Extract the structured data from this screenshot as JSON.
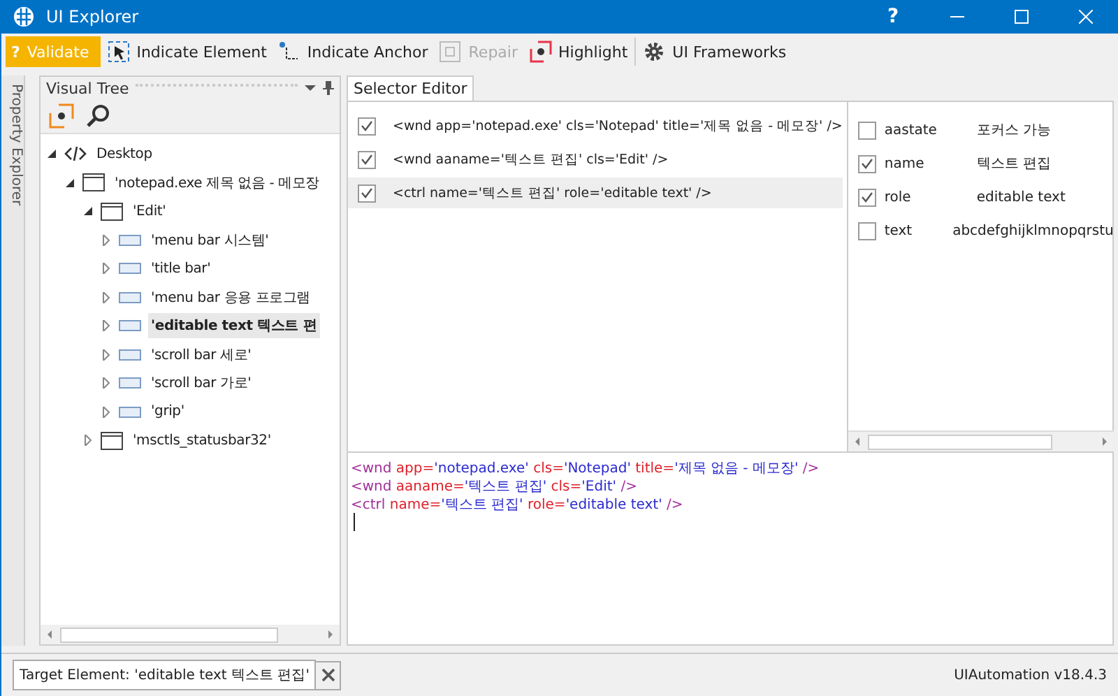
{
  "window": {
    "title": "UI Explorer",
    "help": "?"
  },
  "toolbar": [
    {
      "label": "Validate",
      "glyph": "?",
      "kind": "primary",
      "disabled": false
    },
    {
      "label": "Indicate Element",
      "kind": "element",
      "disabled": false
    },
    {
      "label": "Indicate Anchor",
      "kind": "anchor",
      "disabled": false
    },
    {
      "label": "Repair",
      "kind": "repair",
      "disabled": true
    },
    {
      "label": "Highlight",
      "kind": "highlight",
      "disabled": false
    },
    {
      "label": "UI Frameworks",
      "kind": "gear",
      "disabled": false
    }
  ],
  "side_tab": {
    "label": "Property Explorer"
  },
  "visual_tree": {
    "title": "Visual Tree",
    "items": [
      {
        "label": "Desktop",
        "kind": "desktop",
        "expanded": true,
        "selected": false,
        "children": [
          {
            "label": "'notepad.exe  제목 없음 - 메모장",
            "kind": "window",
            "expanded": true,
            "selected": false,
            "children": [
              {
                "label": "'Edit'",
                "kind": "window",
                "expanded": true,
                "selected": false,
                "children": [
                  {
                    "label": "'menu bar  시스템'",
                    "kind": "control",
                    "expanded": false,
                    "selected": false
                  },
                  {
                    "label": "'title bar'",
                    "kind": "control",
                    "expanded": false,
                    "selected": false
                  },
                  {
                    "label": "'menu bar  응용 프로그램",
                    "kind": "control",
                    "expanded": false,
                    "selected": false
                  },
                  {
                    "label": "'editable text  텍스트 편",
                    "kind": "control",
                    "expanded": false,
                    "selected": true
                  },
                  {
                    "label": "'scroll bar  세로'",
                    "kind": "control",
                    "expanded": false,
                    "selected": false
                  },
                  {
                    "label": "'scroll bar  가로'",
                    "kind": "control",
                    "expanded": false,
                    "selected": false
                  },
                  {
                    "label": "'grip'",
                    "kind": "control",
                    "expanded": false,
                    "selected": false
                  }
                ]
              },
              {
                "label": "'msctls_statusbar32'",
                "kind": "window",
                "expanded": false,
                "selected": false
              }
            ]
          }
        ]
      }
    ]
  },
  "selector_editor": {
    "tab": "Selector Editor",
    "nodes": [
      {
        "text": "<wnd app='notepad.exe' cls='Notepad' title='제목 없음 - 메모장' />",
        "checked": true,
        "selected": false
      },
      {
        "text": "<wnd aaname='텍스트 편집' cls='Edit' />",
        "checked": true,
        "selected": false
      },
      {
        "text": "<ctrl name='텍스트 편집' role='editable text' />",
        "checked": true,
        "selected": true
      }
    ],
    "attributes": [
      {
        "name": "aastate",
        "value": "포커스 가능",
        "checked": false
      },
      {
        "name": "name",
        "value": "텍스트 편집",
        "checked": true
      },
      {
        "name": "role",
        "value": "editable text",
        "checked": true
      },
      {
        "name": "text",
        "value": "abcdefghijklmnopqrstu",
        "checked": false
      }
    ],
    "code": [
      [
        {
          "kind": "tag",
          "text": "<wnd "
        },
        {
          "kind": "attr",
          "text": "app="
        },
        {
          "kind": "value",
          "text": "'notepad.exe' "
        },
        {
          "kind": "attr",
          "text": "cls="
        },
        {
          "kind": "value",
          "text": "'Notepad' "
        },
        {
          "kind": "attr",
          "text": "title="
        },
        {
          "kind": "value",
          "text": "'제목 없음 - 메모장' "
        },
        {
          "kind": "tag",
          "text": "/>"
        }
      ],
      [
        {
          "kind": "tag",
          "text": "<wnd "
        },
        {
          "kind": "attr",
          "text": "aaname="
        },
        {
          "kind": "value",
          "text": "'텍스트 편집' "
        },
        {
          "kind": "attr",
          "text": "cls="
        },
        {
          "kind": "value",
          "text": "'Edit' "
        },
        {
          "kind": "tag",
          "text": "/>"
        }
      ],
      [
        {
          "kind": "tag",
          "text": "<ctrl "
        },
        {
          "kind": "attr",
          "text": "name="
        },
        {
          "kind": "value",
          "text": "'텍스트 편집' "
        },
        {
          "kind": "attr",
          "text": "role="
        },
        {
          "kind": "value",
          "text": "'editable text' "
        },
        {
          "kind": "tag",
          "text": "/>"
        }
      ]
    ]
  },
  "status_bar": {
    "target": "Target Element: 'editable text  텍스트 편집'",
    "version": "UIAutomation v18.4.3"
  }
}
